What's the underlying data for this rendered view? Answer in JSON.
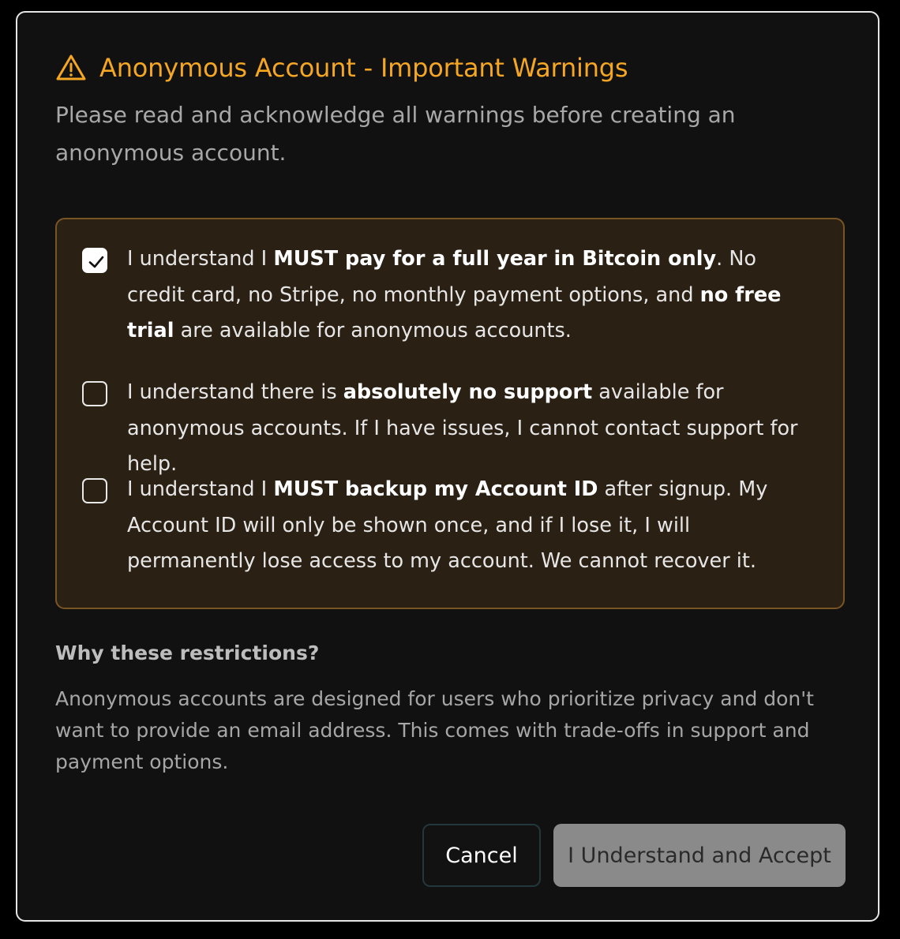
{
  "dialog": {
    "title": "Anonymous Account - Important Warnings",
    "title_icon": "warning-triangle-icon",
    "subtitle": "Please read and acknowledge all warnings before creating an anonymous account.",
    "accent_color": "#f5a623"
  },
  "warnings": [
    {
      "checked": true,
      "parts": [
        {
          "text": "I understand I ",
          "bold": false
        },
        {
          "text": "MUST pay for a full year in Bitcoin only",
          "bold": true
        },
        {
          "text": ". No credit card, no Stripe, no monthly payment options, and ",
          "bold": false
        },
        {
          "text": "no free trial",
          "bold": true
        },
        {
          "text": " are available for anonymous accounts.",
          "bold": false
        }
      ]
    },
    {
      "checked": false,
      "parts": [
        {
          "text": "I understand there is ",
          "bold": false
        },
        {
          "text": "absolutely no support",
          "bold": true
        },
        {
          "text": " available for anonymous accounts. If I have issues, I cannot contact support for help.",
          "bold": false
        }
      ]
    },
    {
      "checked": false,
      "parts": [
        {
          "text": "I understand I ",
          "bold": false
        },
        {
          "text": "MUST backup my Account ID",
          "bold": true
        },
        {
          "text": " after signup. My Account ID will only be shown once, and if I lose it, I will permanently lose access to my account. We cannot recover it.",
          "bold": false
        }
      ]
    }
  ],
  "why": {
    "title": "Why these restrictions?",
    "body": "Anonymous accounts are designed for users who prioritize privacy and don't want to provide an email address. This comes with trade-offs in support and payment options."
  },
  "buttons": {
    "cancel_label": "Cancel",
    "accept_label": "I Understand and Accept"
  }
}
